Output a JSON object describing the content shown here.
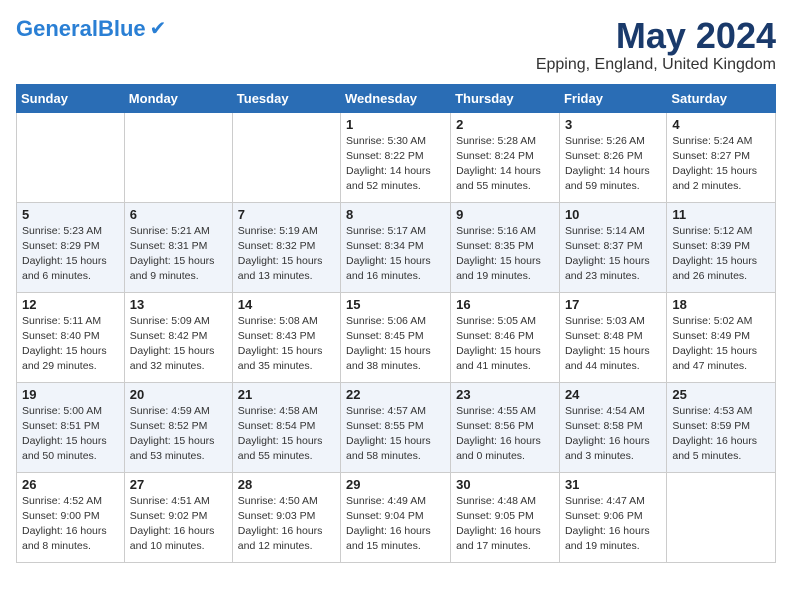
{
  "header": {
    "logo_general": "General",
    "logo_blue": "Blue",
    "month": "May 2024",
    "location": "Epping, England, United Kingdom"
  },
  "days_of_week": [
    "Sunday",
    "Monday",
    "Tuesday",
    "Wednesday",
    "Thursday",
    "Friday",
    "Saturday"
  ],
  "weeks": [
    [
      {
        "day": "",
        "info": ""
      },
      {
        "day": "",
        "info": ""
      },
      {
        "day": "",
        "info": ""
      },
      {
        "day": "1",
        "info": "Sunrise: 5:30 AM\nSunset: 8:22 PM\nDaylight: 14 hours\nand 52 minutes."
      },
      {
        "day": "2",
        "info": "Sunrise: 5:28 AM\nSunset: 8:24 PM\nDaylight: 14 hours\nand 55 minutes."
      },
      {
        "day": "3",
        "info": "Sunrise: 5:26 AM\nSunset: 8:26 PM\nDaylight: 14 hours\nand 59 minutes."
      },
      {
        "day": "4",
        "info": "Sunrise: 5:24 AM\nSunset: 8:27 PM\nDaylight: 15 hours\nand 2 minutes."
      }
    ],
    [
      {
        "day": "5",
        "info": "Sunrise: 5:23 AM\nSunset: 8:29 PM\nDaylight: 15 hours\nand 6 minutes."
      },
      {
        "day": "6",
        "info": "Sunrise: 5:21 AM\nSunset: 8:31 PM\nDaylight: 15 hours\nand 9 minutes."
      },
      {
        "day": "7",
        "info": "Sunrise: 5:19 AM\nSunset: 8:32 PM\nDaylight: 15 hours\nand 13 minutes."
      },
      {
        "day": "8",
        "info": "Sunrise: 5:17 AM\nSunset: 8:34 PM\nDaylight: 15 hours\nand 16 minutes."
      },
      {
        "day": "9",
        "info": "Sunrise: 5:16 AM\nSunset: 8:35 PM\nDaylight: 15 hours\nand 19 minutes."
      },
      {
        "day": "10",
        "info": "Sunrise: 5:14 AM\nSunset: 8:37 PM\nDaylight: 15 hours\nand 23 minutes."
      },
      {
        "day": "11",
        "info": "Sunrise: 5:12 AM\nSunset: 8:39 PM\nDaylight: 15 hours\nand 26 minutes."
      }
    ],
    [
      {
        "day": "12",
        "info": "Sunrise: 5:11 AM\nSunset: 8:40 PM\nDaylight: 15 hours\nand 29 minutes."
      },
      {
        "day": "13",
        "info": "Sunrise: 5:09 AM\nSunset: 8:42 PM\nDaylight: 15 hours\nand 32 minutes."
      },
      {
        "day": "14",
        "info": "Sunrise: 5:08 AM\nSunset: 8:43 PM\nDaylight: 15 hours\nand 35 minutes."
      },
      {
        "day": "15",
        "info": "Sunrise: 5:06 AM\nSunset: 8:45 PM\nDaylight: 15 hours\nand 38 minutes."
      },
      {
        "day": "16",
        "info": "Sunrise: 5:05 AM\nSunset: 8:46 PM\nDaylight: 15 hours\nand 41 minutes."
      },
      {
        "day": "17",
        "info": "Sunrise: 5:03 AM\nSunset: 8:48 PM\nDaylight: 15 hours\nand 44 minutes."
      },
      {
        "day": "18",
        "info": "Sunrise: 5:02 AM\nSunset: 8:49 PM\nDaylight: 15 hours\nand 47 minutes."
      }
    ],
    [
      {
        "day": "19",
        "info": "Sunrise: 5:00 AM\nSunset: 8:51 PM\nDaylight: 15 hours\nand 50 minutes."
      },
      {
        "day": "20",
        "info": "Sunrise: 4:59 AM\nSunset: 8:52 PM\nDaylight: 15 hours\nand 53 minutes."
      },
      {
        "day": "21",
        "info": "Sunrise: 4:58 AM\nSunset: 8:54 PM\nDaylight: 15 hours\nand 55 minutes."
      },
      {
        "day": "22",
        "info": "Sunrise: 4:57 AM\nSunset: 8:55 PM\nDaylight: 15 hours\nand 58 minutes."
      },
      {
        "day": "23",
        "info": "Sunrise: 4:55 AM\nSunset: 8:56 PM\nDaylight: 16 hours\nand 0 minutes."
      },
      {
        "day": "24",
        "info": "Sunrise: 4:54 AM\nSunset: 8:58 PM\nDaylight: 16 hours\nand 3 minutes."
      },
      {
        "day": "25",
        "info": "Sunrise: 4:53 AM\nSunset: 8:59 PM\nDaylight: 16 hours\nand 5 minutes."
      }
    ],
    [
      {
        "day": "26",
        "info": "Sunrise: 4:52 AM\nSunset: 9:00 PM\nDaylight: 16 hours\nand 8 minutes."
      },
      {
        "day": "27",
        "info": "Sunrise: 4:51 AM\nSunset: 9:02 PM\nDaylight: 16 hours\nand 10 minutes."
      },
      {
        "day": "28",
        "info": "Sunrise: 4:50 AM\nSunset: 9:03 PM\nDaylight: 16 hours\nand 12 minutes."
      },
      {
        "day": "29",
        "info": "Sunrise: 4:49 AM\nSunset: 9:04 PM\nDaylight: 16 hours\nand 15 minutes."
      },
      {
        "day": "30",
        "info": "Sunrise: 4:48 AM\nSunset: 9:05 PM\nDaylight: 16 hours\nand 17 minutes."
      },
      {
        "day": "31",
        "info": "Sunrise: 4:47 AM\nSunset: 9:06 PM\nDaylight: 16 hours\nand 19 minutes."
      },
      {
        "day": "",
        "info": ""
      }
    ]
  ]
}
